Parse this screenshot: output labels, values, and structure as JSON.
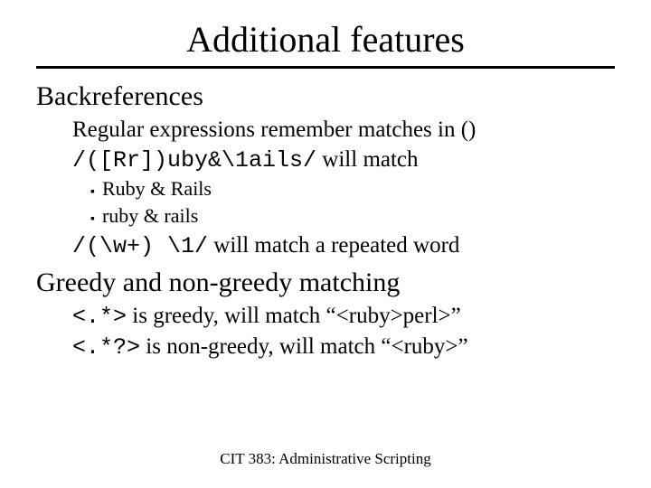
{
  "title": "Additional features",
  "section1": {
    "heading": "Backreferences",
    "line1": "Regular expressions remember matches in ()",
    "line2_code": "/([Rr])uby&\\1ails/",
    "line2_tail": " will match",
    "bullet1": "Ruby & Rails",
    "bullet2": "ruby & rails",
    "line3_code": "/(\\w+) \\1/",
    "line3_tail": " will match a repeated word"
  },
  "section2": {
    "heading": "Greedy and non-greedy matching",
    "line1_code": "<.*>",
    "line1_tail": " is greedy, will match “<ruby>perl>”",
    "line2_code": "<.*?>",
    "line2_tail": " is non-greedy, will match “<ruby>”"
  },
  "footer": "CIT 383: Administrative Scripting"
}
